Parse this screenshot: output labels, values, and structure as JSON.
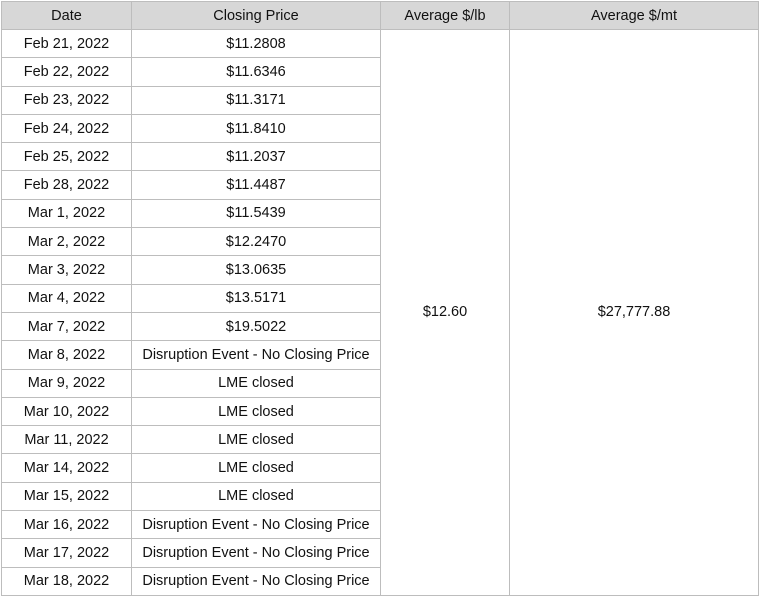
{
  "table": {
    "headers": [
      "Date",
      "Closing Price",
      "Average $/lb",
      "Average $/mt"
    ],
    "rows": [
      {
        "date": "Feb 21, 2022",
        "closing": "$11.2808"
      },
      {
        "date": "Feb 22, 2022",
        "closing": "$11.6346"
      },
      {
        "date": "Feb 23, 2022",
        "closing": "$11.3171"
      },
      {
        "date": "Feb 24, 2022",
        "closing": "$11.8410"
      },
      {
        "date": "Feb 25, 2022",
        "closing": "$11.2037"
      },
      {
        "date": "Feb 28, 2022",
        "closing": "$11.4487"
      },
      {
        "date": "Mar 1, 2022",
        "closing": "$11.5439"
      },
      {
        "date": "Mar 2, 2022",
        "closing": "$12.2470"
      },
      {
        "date": "Mar 3, 2022",
        "closing": "$13.0635"
      },
      {
        "date": "Mar 4, 2022",
        "closing": "$13.5171"
      },
      {
        "date": "Mar 7, 2022",
        "closing": "$19.5022"
      },
      {
        "date": "Mar 8, 2022",
        "closing": "Disruption Event - No Closing Price"
      },
      {
        "date": "Mar 9, 2022",
        "closing": "LME closed"
      },
      {
        "date": "Mar 10, 2022",
        "closing": "LME closed"
      },
      {
        "date": "Mar 11, 2022",
        "closing": "LME closed"
      },
      {
        "date": "Mar 14, 2022",
        "closing": "LME closed"
      },
      {
        "date": "Mar 15, 2022",
        "closing": "LME closed"
      },
      {
        "date": "Mar 16, 2022",
        "closing": "Disruption Event - No Closing Price"
      },
      {
        "date": "Mar 17, 2022",
        "closing": "Disruption Event - No Closing Price"
      },
      {
        "date": "Mar 18, 2022",
        "closing": "Disruption Event - No Closing Price"
      }
    ],
    "average_lb": "$12.60",
    "average_mt": "$27,777.88"
  }
}
